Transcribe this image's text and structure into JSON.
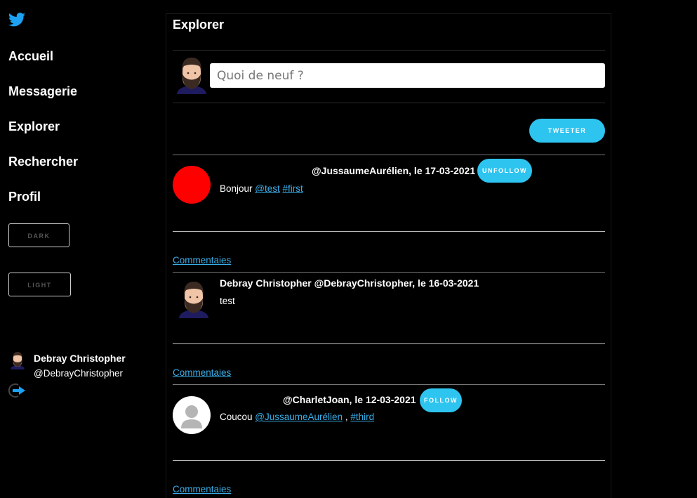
{
  "sidebar": {
    "logo_icon": "twitter-bird-icon",
    "nav": [
      "Accueil",
      "Messagerie",
      "Explorer",
      "Rechercher",
      "Profil"
    ],
    "theme_buttons": [
      "DARK",
      "LIGHT"
    ],
    "user": {
      "name": "Debray Christopher",
      "handle": "@DebrayChristopher",
      "logout_icon": "logout-icon"
    }
  },
  "main": {
    "title": "Explorer",
    "compose": {
      "placeholder": "Quoi de neuf ?",
      "button": "TWEETER"
    },
    "comments_label": "Commentaies",
    "tweets": [
      {
        "author_name": "",
        "meta": "@JussaumeAurélien, le 17-03-2021",
        "action": "UNFOLLOW",
        "avatar": "red-circle",
        "text_prefix": "Bonjour ",
        "links": [
          "@test",
          "#first"
        ]
      },
      {
        "author_name": "Debray Christopher",
        "meta": "Debray Christopher @DebrayChristopher, le 16-03-2021",
        "action": "",
        "avatar": "bearded-man",
        "text_prefix": "test",
        "links": []
      },
      {
        "author_name": "",
        "meta": "@CharletJoan, le 12-03-2021",
        "action": "FOLLOW",
        "avatar": "default-user",
        "text_prefix": "Coucou ",
        "links": [
          "@JussaumeAurélien",
          "#third"
        ],
        "separator": " , "
      }
    ]
  },
  "colors": {
    "accent": "#2ec4f0",
    "link": "#3aaee8",
    "background": "#000000",
    "text": "#ffffff",
    "red_avatar": "#ff0000"
  }
}
